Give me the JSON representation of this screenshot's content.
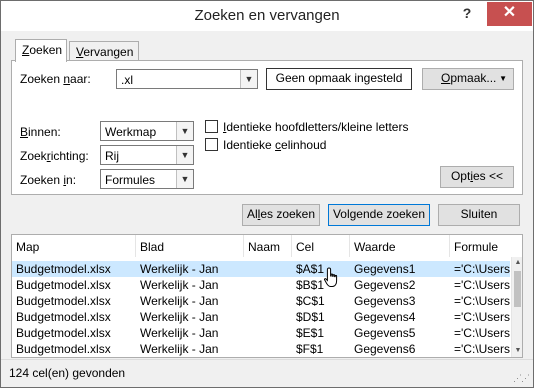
{
  "window": {
    "title": "Zoeken en vervangen",
    "help_label": "?",
    "close_label": "✕"
  },
  "tabs": [
    {
      "label": "Zoeken",
      "accel": "Z",
      "rest": "oeken",
      "active": true
    },
    {
      "label": "Vervangen",
      "accel": "V",
      "rest": "ervangen",
      "active": false
    }
  ],
  "find": {
    "label_pre": "Zoeken ",
    "label_accel": "n",
    "label_post": "aar:",
    "value": ".xl",
    "format_preview": "Geen opmaak ingesteld",
    "format_button_accel": "O",
    "format_button_rest": "pmaak...",
    "dropdown_icon": "chevron-down-icon"
  },
  "options": {
    "within_accel": "B",
    "within_rest": "innen:",
    "within_value": "Werkmap",
    "direction_pre": "Zoek",
    "direction_accel": "r",
    "direction_post": "ichting:",
    "direction_value": "Rij",
    "lookin_pre": "Zoeken ",
    "lookin_accel": "i",
    "lookin_post": "n:",
    "lookin_value": "Formules",
    "match_case_accel": "I",
    "match_case_rest": "dentieke hoofdletters/kleine letters",
    "match_case_checked": false,
    "match_cell_pre": "Identieke ",
    "match_cell_accel": "c",
    "match_cell_post": "elinhoud",
    "match_cell_checked": false,
    "options_button_pre": "Opt",
    "options_button_accel": "i",
    "options_button_post": "es <<"
  },
  "buttons": {
    "find_all_pre": "Al",
    "find_all_accel": "l",
    "find_all_post": "es zoeken",
    "find_next_pre": "Volgende zoeken",
    "close": "Sluiten"
  },
  "results": {
    "columns": [
      "Map",
      "Blad",
      "Naam",
      "Cel",
      "Waarde",
      "Formule"
    ],
    "rows": [
      {
        "map": "Budgetmodel.xlsx",
        "blad": "Werkelijk - Jan",
        "naam": "",
        "cel": "$A$1",
        "waarde": "Gegevens1",
        "formule": "='C:\\Users\\...",
        "selected": true
      },
      {
        "map": "Budgetmodel.xlsx",
        "blad": "Werkelijk - Jan",
        "naam": "",
        "cel": "$B$1",
        "waarde": "Gegevens2",
        "formule": "='C:\\Users\\...",
        "selected": false
      },
      {
        "map": "Budgetmodel.xlsx",
        "blad": "Werkelijk - Jan",
        "naam": "",
        "cel": "$C$1",
        "waarde": "Gegevens3",
        "formule": "='C:\\Users\\...",
        "selected": false
      },
      {
        "map": "Budgetmodel.xlsx",
        "blad": "Werkelijk - Jan",
        "naam": "",
        "cel": "$D$1",
        "waarde": "Gegevens4",
        "formule": "='C:\\Users\\...",
        "selected": false
      },
      {
        "map": "Budgetmodel.xlsx",
        "blad": "Werkelijk - Jan",
        "naam": "",
        "cel": "$E$1",
        "waarde": "Gegevens5",
        "formule": "='C:\\Users\\...",
        "selected": false
      },
      {
        "map": "Budgetmodel.xlsx",
        "blad": "Werkelijk - Jan",
        "naam": "",
        "cel": "$F$1",
        "waarde": "Gegevens6",
        "formule": "='C:\\Users\\...",
        "selected": false
      }
    ]
  },
  "status": {
    "text": "124 cel(en) gevonden"
  },
  "colors": {
    "selection": "#cce8ff",
    "close_button": "#c75050",
    "default_button_border": "#0078d7"
  }
}
